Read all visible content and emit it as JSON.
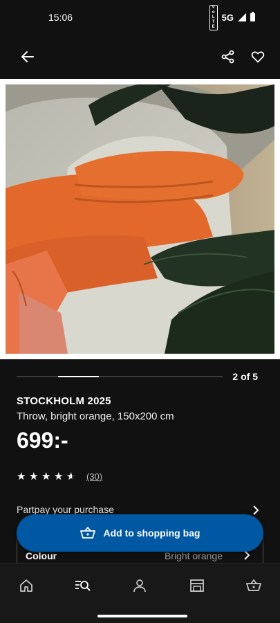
{
  "status_bar": {
    "time": "15:06",
    "network": "5G",
    "volte": "Vo LTE"
  },
  "product": {
    "brand": "STOCKHOLM 2025",
    "description": "Throw, bright orange, 150x200 cm",
    "price": "699:-",
    "rating_value": 4.5,
    "rating_max": 5,
    "review_count": "(30)"
  },
  "carousel": {
    "page_label": "2 of 5",
    "current": 2,
    "total": 5
  },
  "partpay": {
    "label": "Partpay your purchase"
  },
  "colour": {
    "label": "Colour",
    "value": "Bright orange"
  },
  "cta": {
    "label": "Add to shopping bag"
  },
  "nav": [
    "home",
    "search-products",
    "profile",
    "store",
    "shopping-bag"
  ],
  "colors": {
    "background": "#111111",
    "accent": "#0058a3",
    "text": "#ffffff"
  }
}
